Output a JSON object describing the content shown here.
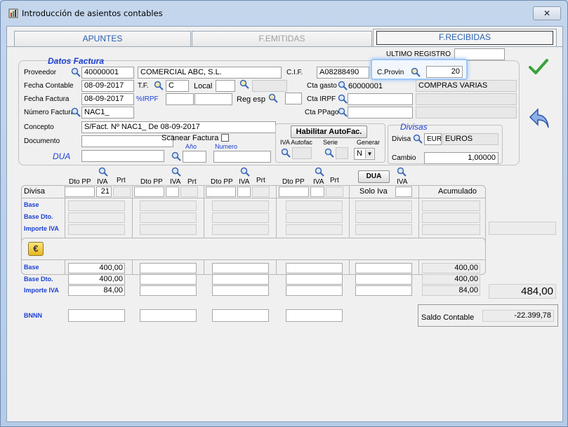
{
  "window": {
    "title": "Introducción de asientos contables",
    "close_label": "✕"
  },
  "tabs": [
    {
      "label": "APUNTES"
    },
    {
      "label": "F.EMITIDAS"
    },
    {
      "label": "F.RECIBIDAS"
    }
  ],
  "ultimo_registro": {
    "label": "ULTIMO REGISTRO",
    "value": ""
  },
  "datos_factura": {
    "heading": "Datos Factura",
    "proveedor": {
      "label": "Proveedor",
      "code": "40000001",
      "name": "COMERCIAL ABC, S.L."
    },
    "cif": {
      "label": "C.I.F.",
      "value": "A08288490"
    },
    "cprovin": {
      "label": "C.Provin",
      "value": "20"
    },
    "fecha_contable": {
      "label": "Fecha Contable",
      "value": "08-09-2017"
    },
    "tf": {
      "label": "T.F.",
      "value": "C"
    },
    "local": {
      "label": "Local",
      "value": ""
    },
    "cta_gasto": {
      "label": "Cta gasto",
      "code": "60000001",
      "name": "COMPRAS VARIAS"
    },
    "fecha_factura": {
      "label": "Fecha Factura",
      "value": "08-09-2017"
    },
    "irpf": {
      "label": "%IRPF",
      "value": ""
    },
    "reg_esp": {
      "label": "Reg esp",
      "value": ""
    },
    "cta_irpf": {
      "label": "Cta  IRPF",
      "value": ""
    },
    "numero_factura": {
      "label": "Número Factura",
      "value": "NAC1_"
    },
    "cta_ppago": {
      "label": "Cta PPago",
      "value": ""
    },
    "concepto": {
      "label": "Concepto",
      "value": "S/Fact. Nº NAC1_ De 08-09-2017"
    },
    "documento": {
      "label": "Documento",
      "value": ""
    },
    "scanear": {
      "label": "Scanear Factura"
    },
    "dua": {
      "label": "DUA",
      "anio_label": "Año",
      "numero_label": "Numero"
    }
  },
  "autofac": {
    "button": "Habilitar AutoFac.",
    "iva_autofac": "IVA Autofac",
    "serie": "Serie",
    "generar": "Generar",
    "generar_value": "N"
  },
  "divisas": {
    "heading": "Divisas",
    "divisa_label": "Divisa",
    "code": "EUR",
    "name": "EUROS",
    "cambio_label": "Cambio",
    "cambio": "1,00000"
  },
  "grid": {
    "col_headers": {
      "dto_pp": "Dto PP",
      "iva": "IVA",
      "prt": "Prt",
      "dua_button": "DUA"
    },
    "divisa_label": "Divisa",
    "iva1": "21",
    "solo_iva": "Solo Iva",
    "acumulado": "Acumulado",
    "row_labels": [
      "Base",
      "Base Dto.",
      "Importe IVA"
    ],
    "col1": [
      "400,00",
      "400,00",
      "84,00"
    ],
    "acum": [
      "400,00",
      "400,00",
      "84,00"
    ],
    "total": "484,00",
    "bnnn": "BNNN"
  },
  "saldo": {
    "label": "Saldo Contable",
    "value": "-22.399,78"
  }
}
